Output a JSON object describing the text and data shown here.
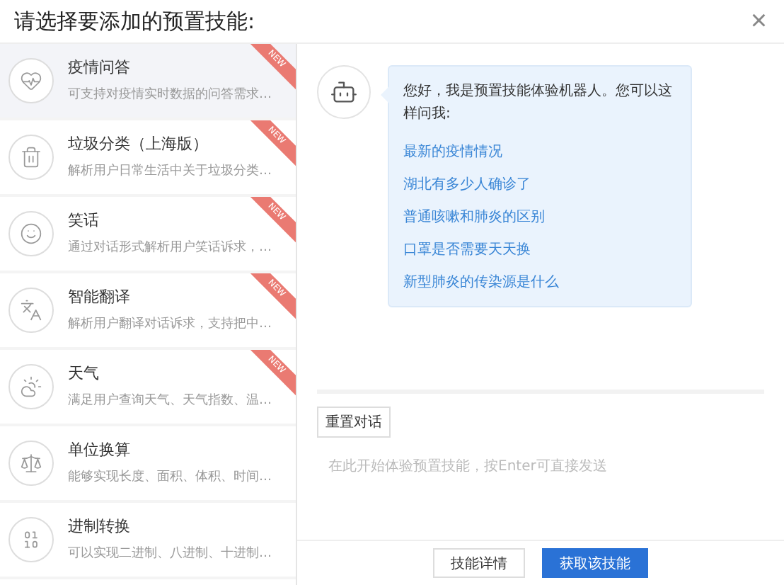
{
  "dialog": {
    "title": "请选择要添加的预置技能:",
    "close": "×"
  },
  "skills": [
    {
      "name": "疫情问答",
      "desc": "可支持对疫情实时数据的问答需求…",
      "badge": "NEW",
      "selected": true
    },
    {
      "name": "垃圾分类（上海版）",
      "desc": "解析用户日常生活中关于垃圾分类…",
      "badge": "NEW",
      "selected": false
    },
    {
      "name": "笑话",
      "desc": "通过对话形式解析用户笑话诉求，…",
      "badge": "NEW",
      "selected": false
    },
    {
      "name": "智能翻译",
      "desc": "解析用户翻译对话诉求，支持把中…",
      "badge": "NEW",
      "selected": false
    },
    {
      "name": "天气",
      "desc": "满足用户查询天气、天气指数、温…",
      "badge": "NEW",
      "selected": false
    },
    {
      "name": "单位换算",
      "desc": "能够实现长度、面积、体积、时间…",
      "selected": false
    },
    {
      "name": "进制转换",
      "desc": "可以实现二进制、八进制、十进制…",
      "selected": false
    }
  ],
  "chat": {
    "greeting": "您好，我是预置技能体验机器人。您可以这样问我:",
    "suggestions": [
      "最新的疫情情况",
      "湖北有多少人确诊了",
      "普通咳嗽和肺炎的区别",
      "口罩是否需要天天换",
      "新型肺炎的传染源是什么"
    ]
  },
  "reset_button": "重置对话",
  "input": {
    "placeholder": "在此开始体验预置技能，按Enter可直接发送"
  },
  "buttons": [
    {
      "label": "技能详情",
      "kind": "secondary"
    },
    {
      "label": "获取该技能",
      "kind": "primary"
    }
  ]
}
